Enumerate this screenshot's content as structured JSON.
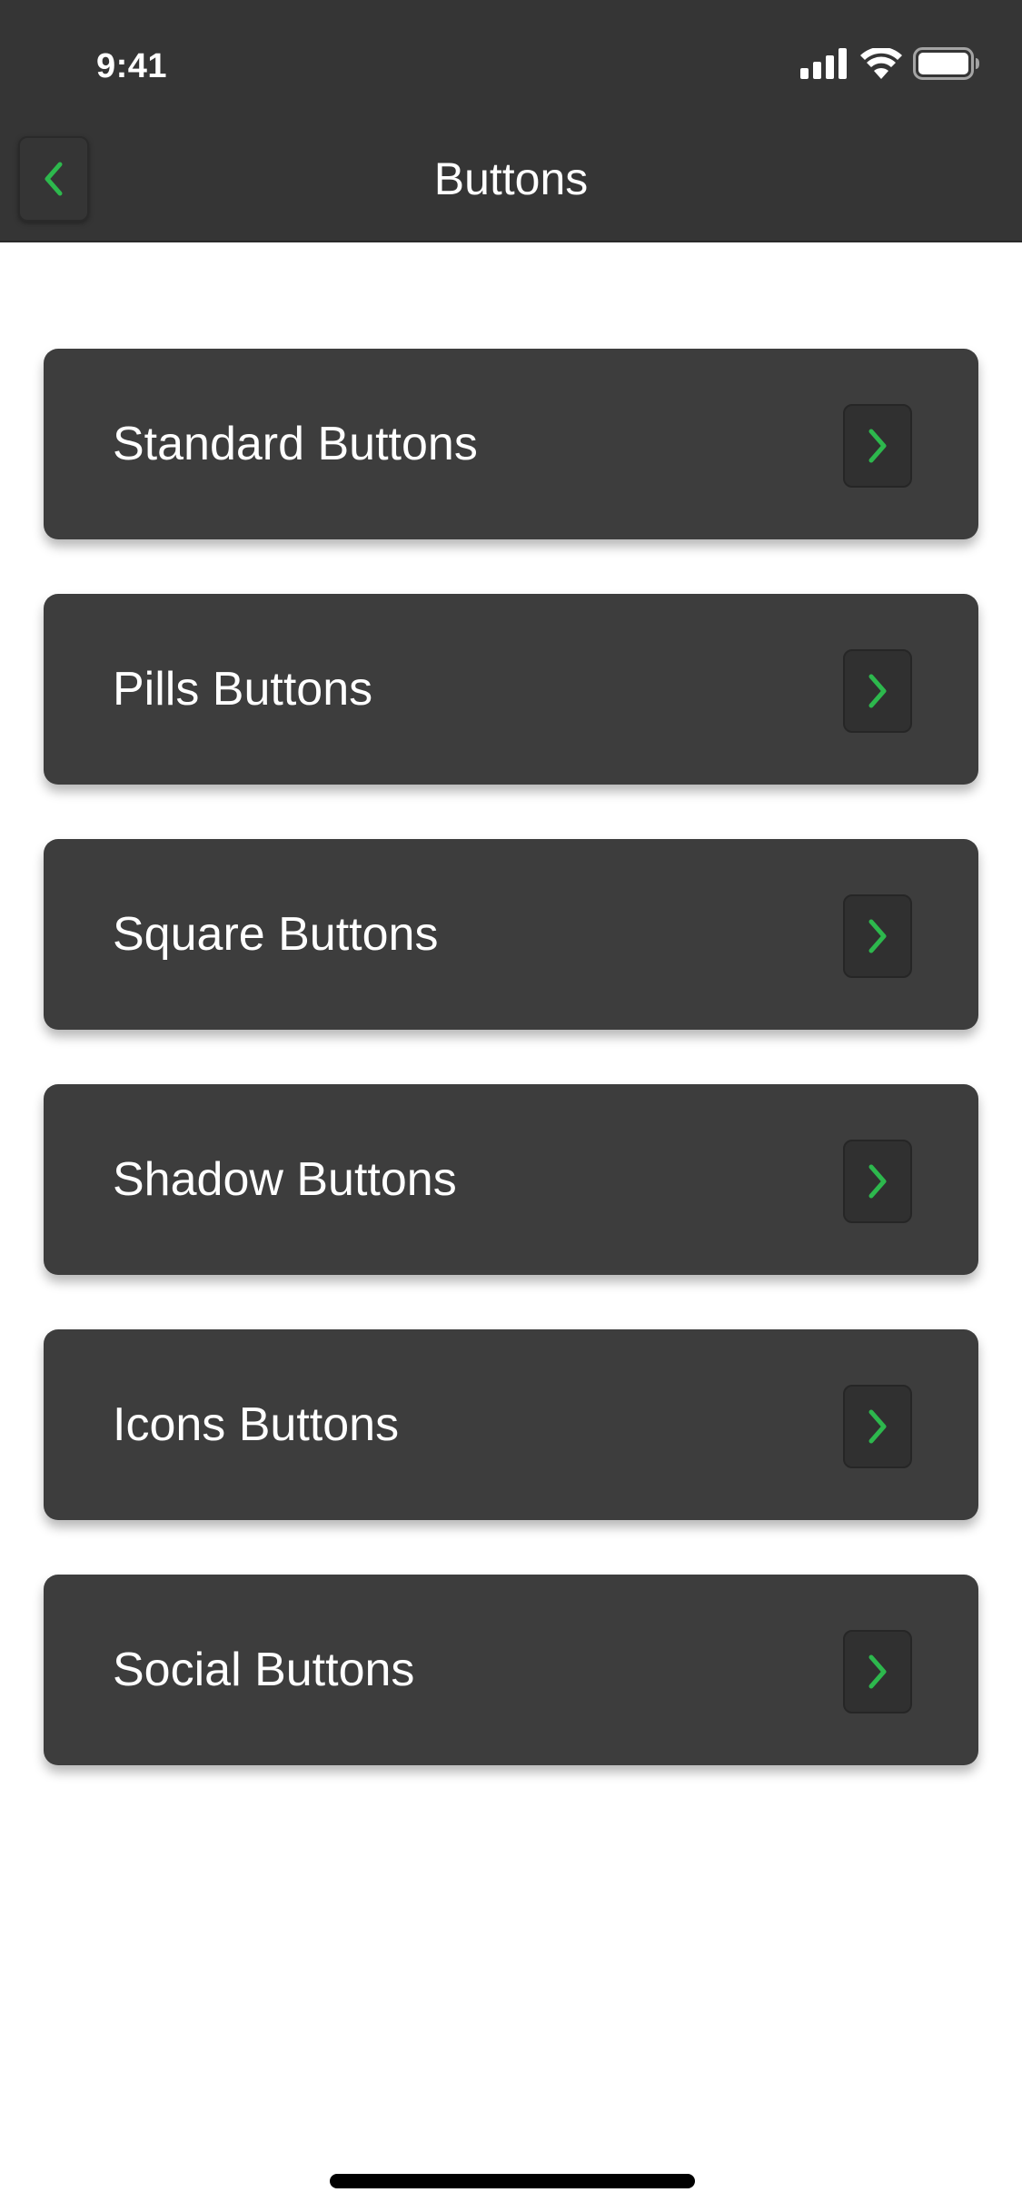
{
  "status_bar": {
    "time": "9:41",
    "icons": [
      "cellular-signal-icon",
      "wifi-icon",
      "battery-icon"
    ]
  },
  "header": {
    "title": "Buttons",
    "back_icon": "chevron-left-icon"
  },
  "menu": {
    "items": [
      {
        "label": "Standard Buttons",
        "icon": "chevron-right-icon"
      },
      {
        "label": "Pills Buttons",
        "icon": "chevron-right-icon"
      },
      {
        "label": "Square Buttons",
        "icon": "chevron-right-icon"
      },
      {
        "label": "Shadow Buttons",
        "icon": "chevron-right-icon"
      },
      {
        "label": "Icons Buttons",
        "icon": "chevron-right-icon"
      },
      {
        "label": "Social Buttons",
        "icon": "chevron-right-icon"
      }
    ]
  },
  "colors": {
    "header_bg": "#353535",
    "card_bg": "#3d3d3d",
    "accent": "#2db84d",
    "page_bg": "#ffffff"
  }
}
